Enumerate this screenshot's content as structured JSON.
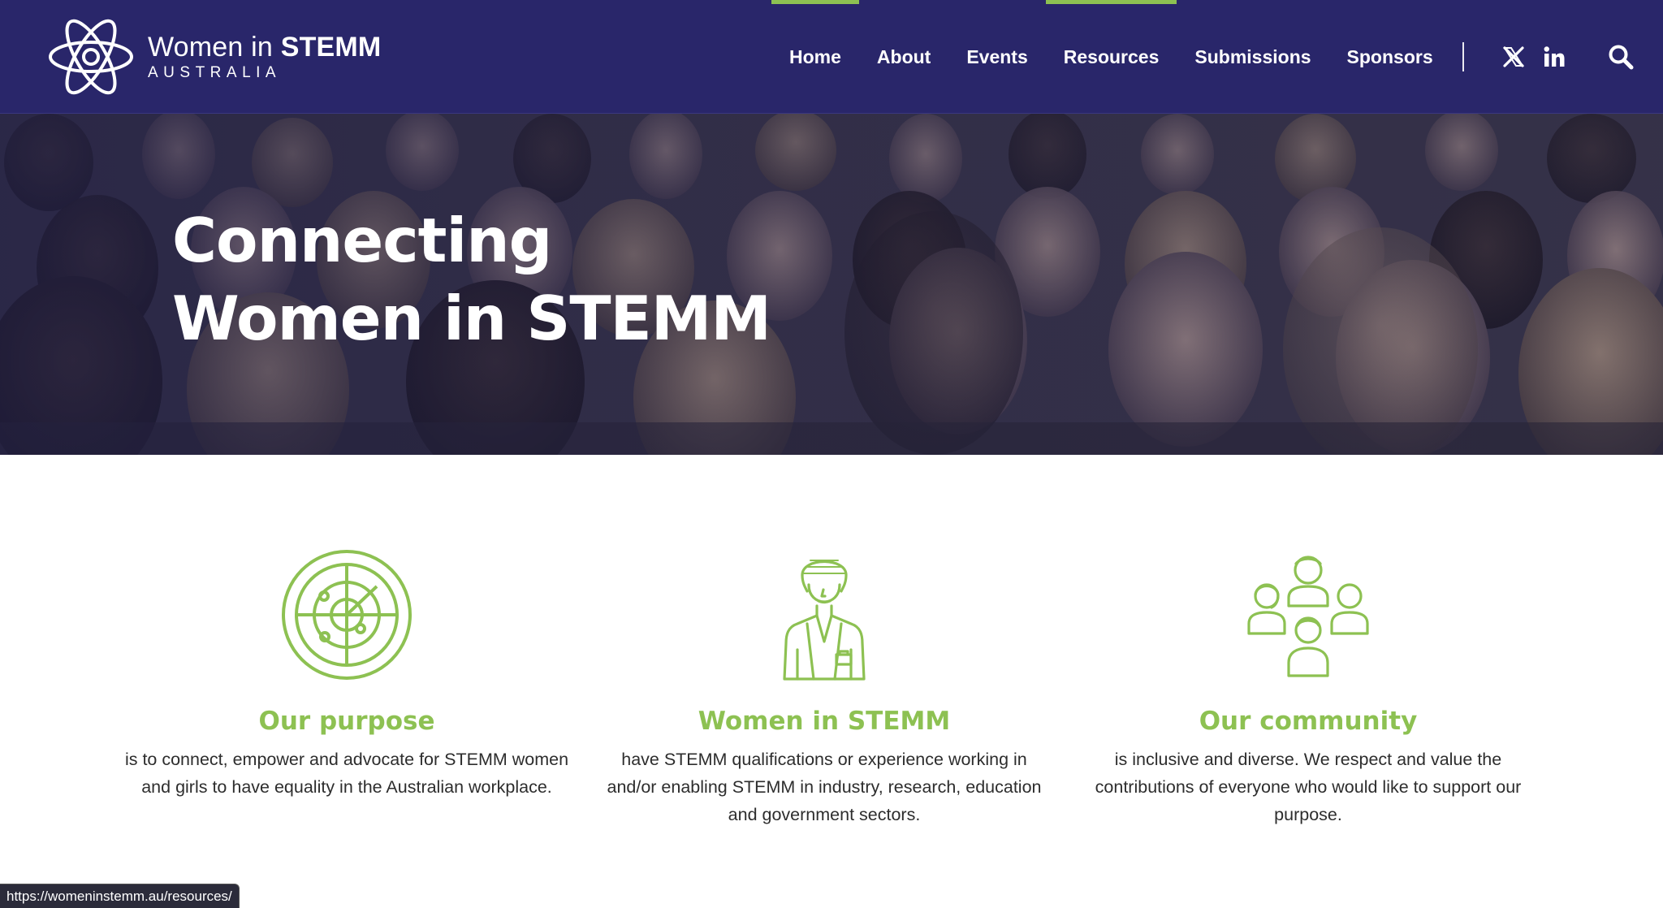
{
  "site": {
    "logo_line1_regular": "Women in ",
    "logo_line1_bold": "STEMM",
    "logo_line2": "AUSTRALIA"
  },
  "nav": {
    "items": [
      {
        "label": "Home"
      },
      {
        "label": "About"
      },
      {
        "label": "Events"
      },
      {
        "label": "Resources"
      },
      {
        "label": "Submissions"
      },
      {
        "label": "Sponsors"
      }
    ],
    "social": [
      "x-icon",
      "linkedin-icon"
    ],
    "search_icon": "search-icon"
  },
  "hero": {
    "title_line1": "Connecting",
    "title_line2": "Women in STEMM"
  },
  "features": [
    {
      "icon": "radar-icon",
      "title": "Our purpose",
      "text": "is to connect, empower and advocate for STEMM women and girls to have equality in the Australian workplace."
    },
    {
      "icon": "scientist-woman-icon",
      "title": "Women in STEMM",
      "text": "have STEMM qualifications or experience working in and/or enabling STEMM in industry, research, education and government sectors."
    },
    {
      "icon": "community-group-icon",
      "title": "Our community",
      "text": "is inclusive and diverse. We respect and value the contributions of everyone who would like to support our purpose."
    }
  ],
  "status_bar": {
    "url": "https://womeninstemm.au/resources/"
  },
  "colors": {
    "header_bg": "#29266a",
    "accent_green": "#8dc152",
    "text_dark": "#2d2d2d"
  }
}
